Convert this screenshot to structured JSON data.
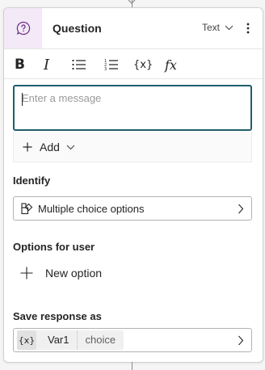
{
  "node": {
    "title": "Question",
    "type_select": "Text",
    "icon": "question-bubble-icon",
    "accent_color": "#f3e9f7"
  },
  "toolbar": {
    "bold_glyph": "B",
    "italic_glyph": "I",
    "variable_glyph": "{x}",
    "formula_glyph": "fx",
    "icons": [
      "bold-icon",
      "italic-icon",
      "bulleted-list-icon",
      "numbered-list-icon",
      "variable-icon",
      "formula-icon"
    ]
  },
  "message": {
    "placeholder": "Enter a message",
    "value": "",
    "focus_color": "#1f5e6b"
  },
  "add_button": {
    "label": "Add"
  },
  "identify": {
    "label": "Identify",
    "value": "Multiple choice options"
  },
  "options": {
    "label": "Options for user",
    "new_option_label": "New option"
  },
  "save_response": {
    "label": "Save response as",
    "chip_icon": "{x}",
    "variable_name": "Var1",
    "variable_type": "choice"
  }
}
